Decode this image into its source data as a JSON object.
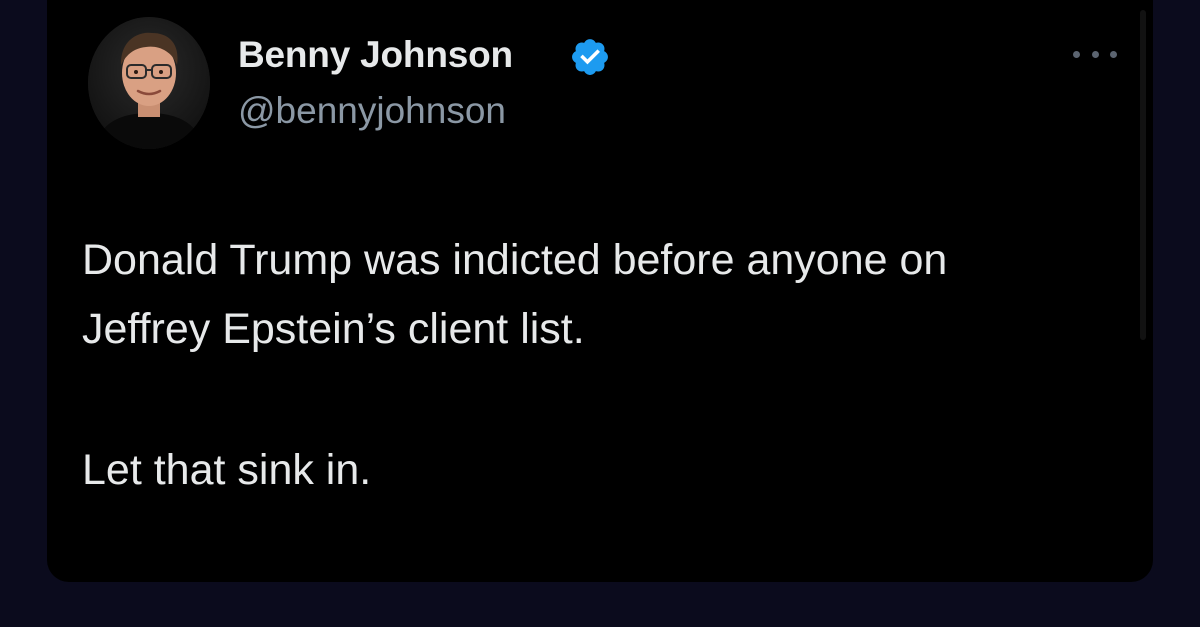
{
  "tweet": {
    "author": {
      "name": "Benny Johnson",
      "handle": "@bennyjohnson",
      "verified": true,
      "verified_color": "#1d9bf0"
    },
    "more_icon": "more-horizontal-icon",
    "text_lines": [
      "Donald Trump was indicted before anyone on",
      "Jeffrey Epstein’s client list.",
      "Let that sink in."
    ]
  },
  "colors": {
    "background": "#0b0b1d",
    "card": "#000000",
    "primary_text": "#e7e9ea",
    "secondary_text": "#8b98a5"
  }
}
